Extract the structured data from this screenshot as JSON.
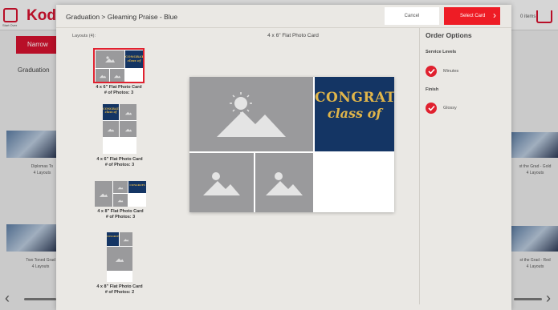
{
  "background": {
    "brand": "Kod",
    "start_over": "Start Over",
    "items": "0 items",
    "narrow_button": "Narrow",
    "category": "Graduation",
    "left_cards": [
      {
        "title": "Diplomas To",
        "layouts": "4 Layouts"
      },
      {
        "title": "Two Toned Grad",
        "layouts": "4 Layouts"
      }
    ],
    "right_cards": [
      {
        "title": "st the Grad - Gold",
        "layouts": "4 Layouts"
      },
      {
        "title": "st the Grad - Red",
        "layouts": "4 Layouts"
      }
    ]
  },
  "modal": {
    "breadcrumb": "Graduation > Gleaming Praise - Blue",
    "cancel_label": "Cancel",
    "select_label": "Select Card",
    "layouts_label": "Layouts (4):",
    "preview_title": "4 x 6\" Flat Photo Card",
    "layouts": [
      {
        "name": "4 x 6\" Flat Photo Card",
        "photos": "# of Photos:  3",
        "selected": true
      },
      {
        "name": "4 x 6\" Flat Photo Card",
        "photos": "# of Photos:  3",
        "selected": false
      },
      {
        "name": "4 x 8\" Flat Photo Card",
        "photos": "# of Photos:  3",
        "selected": false
      },
      {
        "name": "4 x 8\" Flat Photo Card",
        "photos": "# of Photos:  2",
        "selected": false
      }
    ],
    "preview_art": {
      "congrats": "CONGRATS",
      "class_of": "class of"
    }
  },
  "order_options": {
    "title": "Order Options",
    "service_label": "Service Levels",
    "service_value": "Minutes",
    "finish_label": "Finish",
    "finish_value": "Glossy"
  },
  "colors": {
    "accent_red": "#ee1c25",
    "navy": "#143564",
    "gold": "#e0b54a"
  }
}
